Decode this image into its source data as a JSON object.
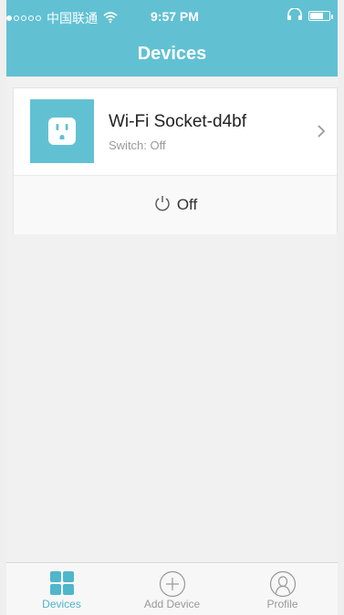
{
  "status_bar": {
    "carrier": "中国联通",
    "time": "9:57 PM"
  },
  "header": {
    "title": "Devices"
  },
  "device": {
    "name": "Wi-Fi Socket-d4bf",
    "status": "Switch: Off",
    "power_label": "Off"
  },
  "tabs": [
    {
      "label": "Devices",
      "icon": "grid-icon",
      "active": true
    },
    {
      "label": "Add Device",
      "icon": "plus-circle-icon",
      "active": false
    },
    {
      "label": "Profile",
      "icon": "person-icon",
      "active": false
    }
  ],
  "colors": {
    "accent": "#61c1d3",
    "tab_active": "#4fb6cb"
  }
}
